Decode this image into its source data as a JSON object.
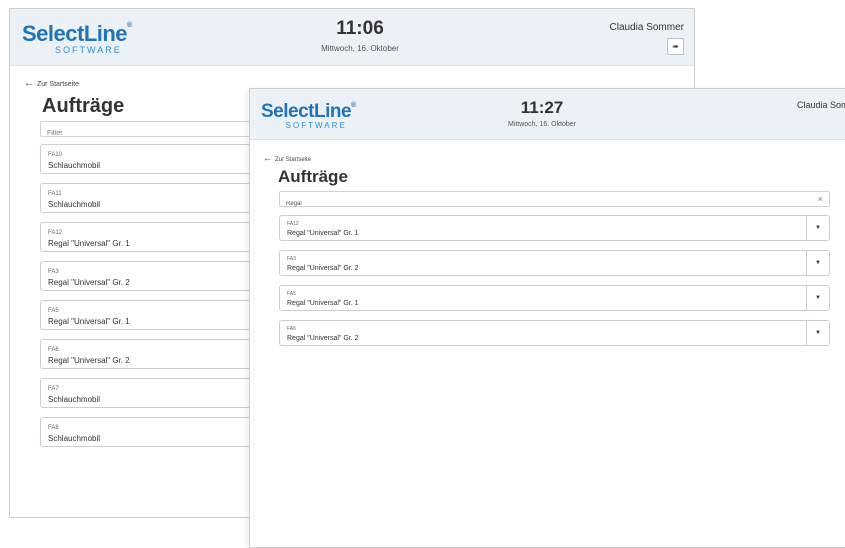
{
  "back_window": {
    "logo": {
      "main": "SelectLine",
      "reg": "®",
      "sub": "SOFTWARE"
    },
    "clock": {
      "time": "11:06",
      "date": "Mittwoch, 16. Oktober"
    },
    "user": {
      "name": "Claudia Sommer",
      "logout_icon": "logout-icon"
    },
    "back_link": "Zur Startseite",
    "page_title": "Aufträge",
    "filter": {
      "value": "",
      "placeholder": "Filter"
    },
    "orders": [
      {
        "code": "FA10",
        "description": "Schlauchmobil"
      },
      {
        "code": "FA11",
        "description": "Schlauchmobil"
      },
      {
        "code": "FA12",
        "description": "Regal \"Universal\" Gr. 1"
      },
      {
        "code": "FA3",
        "description": "Regal \"Universal\" Gr. 2"
      },
      {
        "code": "FA5",
        "description": "Regal \"Universal\" Gr. 1"
      },
      {
        "code": "FA6",
        "description": "Regal \"Universal\" Gr. 2"
      },
      {
        "code": "FA7",
        "description": "Schlauchmobil"
      },
      {
        "code": "FA8",
        "description": "Schlauchmobil"
      }
    ]
  },
  "front_window": {
    "logo": {
      "main": "SelectLine",
      "reg": "®",
      "sub": "SOFTWARE"
    },
    "clock": {
      "time": "11:27",
      "date": "Mittwoch, 16. Oktober"
    },
    "user": {
      "name": "Claudia Sommer",
      "logout_icon": "logout-icon"
    },
    "back_link": "Zur Startseite",
    "page_title": "Aufträge",
    "filter": {
      "value": "Regal",
      "clear_label": "×"
    },
    "orders": [
      {
        "code": "FA12",
        "description": "Regal \"Universal\" Gr. 1"
      },
      {
        "code": "FA3",
        "description": "Regal \"Universal\" Gr. 2"
      },
      {
        "code": "FA5",
        "description": "Regal \"Universal\" Gr. 1"
      },
      {
        "code": "FA6",
        "description": "Regal \"Universal\" Gr. 2"
      }
    ],
    "toggle_icon": "chevron-down-icon"
  },
  "colors": {
    "brand": "#2274b8",
    "header_bg": "#ecf1f7"
  }
}
